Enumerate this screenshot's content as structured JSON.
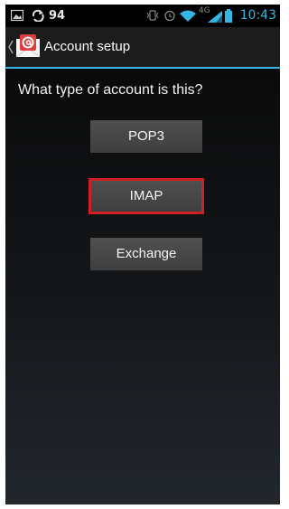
{
  "status_bar": {
    "notification_count": "94",
    "network_label": "4G",
    "time": "10:43",
    "icons": [
      "image-icon",
      "sync-icon",
      "vibrate-icon",
      "alarm-icon",
      "wifi-icon",
      "signal-icon",
      "battery-icon"
    ]
  },
  "action_bar": {
    "title": "Account setup",
    "icons": [
      "back-chevron-icon",
      "email-app-icon"
    ]
  },
  "main": {
    "question": "What type of account is this?",
    "buttons": [
      {
        "label": "POP3",
        "highlighted": false
      },
      {
        "label": "IMAP",
        "highlighted": true
      },
      {
        "label": "Exchange",
        "highlighted": false
      }
    ]
  },
  "colors": {
    "accent": "#33b5e5",
    "highlight_border": "#d11f26",
    "button": "#474747"
  }
}
